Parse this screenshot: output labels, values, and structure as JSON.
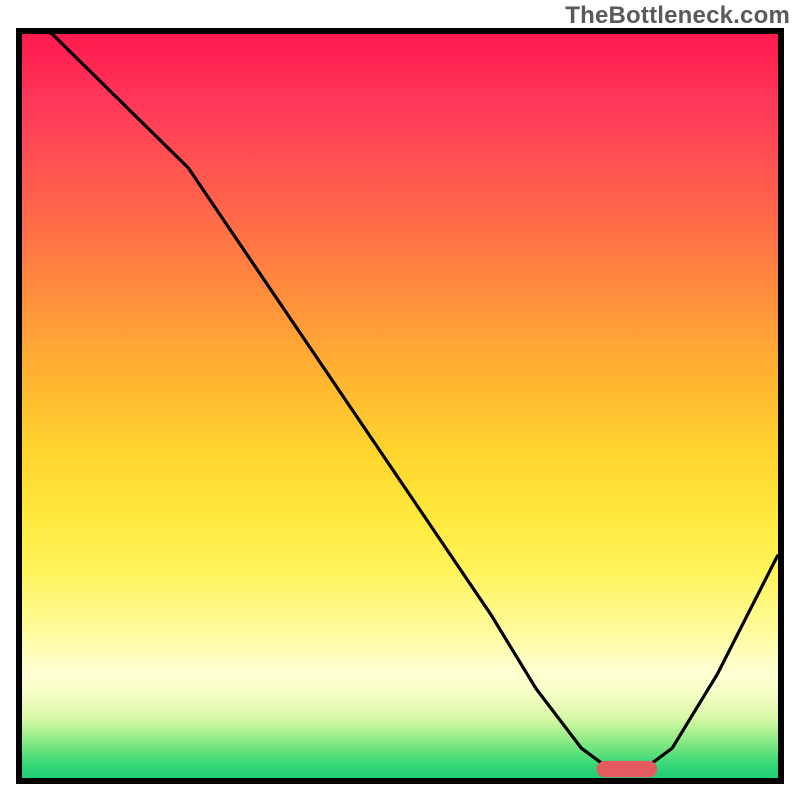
{
  "watermark": "TheBottleneck.com",
  "chart_data": {
    "type": "line",
    "title": "",
    "xlabel": "",
    "ylabel": "",
    "xlim": [
      0,
      100
    ],
    "ylim": [
      0,
      100
    ],
    "x": [
      0,
      4,
      12,
      22,
      30,
      38,
      46,
      54,
      62,
      68,
      74,
      78,
      82,
      86,
      92,
      100
    ],
    "values": [
      102,
      100,
      92,
      82,
      70,
      58,
      46,
      34,
      22,
      12,
      4,
      1,
      1,
      4,
      14,
      30
    ],
    "annotations": [
      {
        "shape": "pill",
        "x": 80,
        "y": 1.2,
        "width_pct": 8,
        "height_pct": 2.2,
        "color": "#e35a5f"
      }
    ],
    "background": "vertical red→yellow→green gradient (heat scale)",
    "grid": false,
    "legend": null
  },
  "frame": {
    "inner_width": 756,
    "inner_height": 744
  }
}
